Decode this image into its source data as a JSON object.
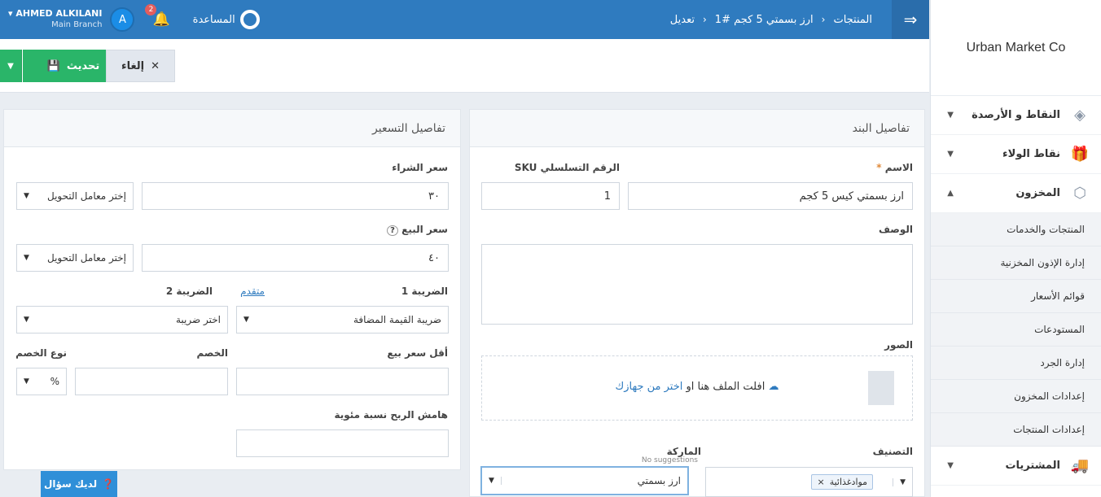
{
  "header": {
    "breadcrumb": [
      "المنتجات",
      "ارز بسمتي 5 كجم #1",
      "تعديل"
    ],
    "help_label": "المساعدة",
    "notifications_count": "2",
    "user_initial": "A",
    "user_name": "AHMED ALKILANI",
    "branch": "Main Branch"
  },
  "actions": {
    "update_label": "تحديث",
    "cancel_label": "إلغاء"
  },
  "sidebar": {
    "company": "Urban Market Co",
    "items": [
      {
        "label": "النقاط و الأرصدة",
        "icon": "layers-icon"
      },
      {
        "label": "نقاط الولاء",
        "icon": "gift-icon"
      },
      {
        "label": "المخزون",
        "icon": "box-icon"
      }
    ],
    "inventory_sub": [
      "المنتجات والخدمات",
      "إدارة الإذون المخزنية",
      "قوائم الأسعار",
      "المستودعات",
      "إدارة الجرد",
      "إعدادات المخزون",
      "إعدادات المنتجات"
    ],
    "purchases": {
      "label": "المشتريات",
      "icon": "truck-icon"
    }
  },
  "item_details": {
    "title": "تفاصيل البند",
    "name_label": "الاسم",
    "name_value": "ارز بسمتي كيس 5 كجم",
    "sku_label": "الرقم التسلسلي SKU",
    "sku_value": "1",
    "description_label": "الوصف",
    "images_label": "الصور",
    "drop_text": "افلت الملف هنا او",
    "drop_link": "اختر من جهازك",
    "category_label": "التصنيف",
    "category_tag": "موادغذائية",
    "brand_label": "الماركة",
    "brand_hint": "No suggestions",
    "brand_value": "ارز بسمتي"
  },
  "pricing": {
    "title": "تفاصيل التسعير",
    "purchase_price_label": "سعر الشراء",
    "purchase_price_value": "٣٠",
    "conversion_placeholder": "إختر معامل التحويل",
    "sale_price_label": "سعر البيع",
    "sale_price_value": "٤٠",
    "tax1_label": "الضريبة 1",
    "advanced_link": "متقدم",
    "tax1_value": "ضريبة القيمة المضافة",
    "tax2_label": "الضريبة 2",
    "tax2_value": "اختر ضريبة",
    "min_price_label": "أقل سعر بيع",
    "discount_label": "الخصم",
    "discount_type_label": "نوع الخصم",
    "discount_type_value": "%",
    "profit_margin_label": "هامش الربح نسبة مئوية"
  },
  "help_button": "لديك سؤال"
}
